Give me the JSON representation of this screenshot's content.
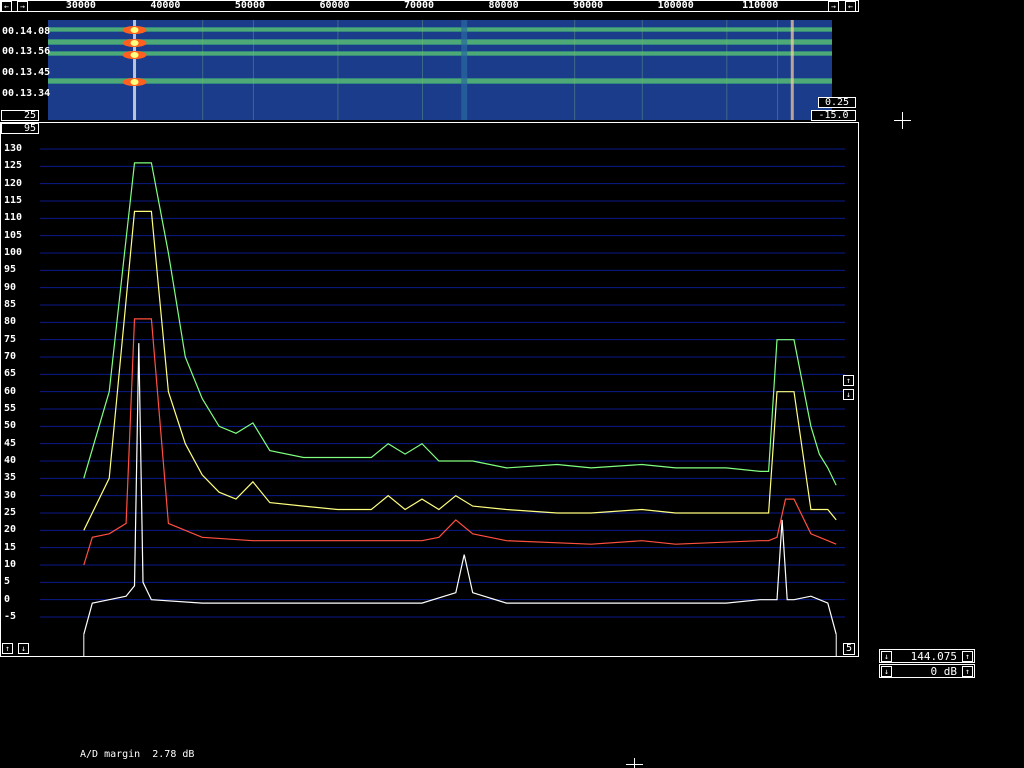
{
  "window": {
    "title": ""
  },
  "waterfall": {
    "freq_ticks": [
      "30000",
      "40000",
      "50000",
      "60000",
      "70000",
      "80000",
      "90000",
      "100000",
      "110000"
    ],
    "time_labels": [
      "00.14.08",
      "00.13.56",
      "00.13.45",
      "00.13.34"
    ],
    "left_value": "25",
    "right_top_value": "0.25",
    "right_bottom_value": "-15.0"
  },
  "spectrum": {
    "top_left_value": "95",
    "y_ticks": [
      "130",
      "125",
      "120",
      "115",
      "110",
      "105",
      "100",
      "95",
      "90",
      "85",
      "80",
      "75",
      "70",
      "65",
      "60",
      "55",
      "50",
      "45",
      "40",
      "35",
      "30",
      "25",
      "20",
      "15",
      "10",
      "5",
      "0",
      "-5"
    ],
    "bottom_right_value": "5"
  },
  "controls": {
    "freq_value": "144.075",
    "gain_value": "0 dB"
  },
  "status": {
    "ad_margin_label": "A/D margin",
    "ad_margin_value": "2.78 dB"
  },
  "colors": {
    "grid": "#0b1a8a",
    "green": "#80ff80",
    "yellow": "#ffff80",
    "red": "#ff5040",
    "white": "#ffffff",
    "waterfall_bg": "#1a3c8a"
  },
  "chart_data": {
    "type": "line",
    "ylim": [
      -5,
      130
    ],
    "xlim": [
      30000,
      120000
    ],
    "series": [
      {
        "color": "green",
        "x": [
          30000,
          33000,
          36000,
          38000,
          40000,
          42000,
          44000,
          46000,
          48000,
          50000,
          52000,
          56000,
          60000,
          64000,
          66000,
          68000,
          70000,
          72000,
          76000,
          80000,
          86000,
          90000,
          96000,
          100000,
          106000,
          110000,
          111000,
          112000,
          114000,
          116000,
          117000,
          118000,
          119000
        ],
        "y": [
          35,
          60,
          126,
          126,
          100,
          70,
          58,
          50,
          48,
          51,
          43,
          41,
          41,
          41,
          45,
          42,
          45,
          40,
          40,
          38,
          39,
          38,
          39,
          38,
          38,
          37,
          37,
          75,
          75,
          50,
          42,
          38,
          33
        ]
      },
      {
        "color": "yellow",
        "x": [
          30000,
          33000,
          36000,
          38000,
          40000,
          42000,
          44000,
          46000,
          48000,
          50000,
          52000,
          56000,
          60000,
          64000,
          66000,
          68000,
          70000,
          72000,
          74000,
          76000,
          80000,
          86000,
          90000,
          96000,
          100000,
          106000,
          110000,
          111000,
          112000,
          114000,
          116000,
          118000,
          119000
        ],
        "y": [
          20,
          35,
          112,
          112,
          60,
          45,
          36,
          31,
          29,
          34,
          28,
          27,
          26,
          26,
          30,
          26,
          29,
          26,
          30,
          27,
          26,
          25,
          25,
          26,
          25,
          25,
          25,
          25,
          60,
          60,
          26,
          26,
          23
        ]
      },
      {
        "color": "red",
        "x": [
          30000,
          31000,
          33000,
          35000,
          36000,
          38000,
          40000,
          44000,
          50000,
          56000,
          64000,
          70000,
          72000,
          74000,
          76000,
          80000,
          90000,
          96000,
          100000,
          110000,
          111000,
          112000,
          113000,
          114000,
          116000,
          118000,
          119000
        ],
        "y": [
          10,
          18,
          19,
          22,
          81,
          81,
          22,
          18,
          17,
          17,
          17,
          17,
          18,
          23,
          19,
          17,
          16,
          17,
          16,
          17,
          17,
          18,
          29,
          29,
          19,
          17,
          16
        ]
      },
      {
        "color": "white",
        "x": [
          30000,
          31000,
          33000,
          35000,
          36000,
          36500,
          37000,
          38000,
          44000,
          50000,
          56000,
          60000,
          64000,
          70000,
          74000,
          75000,
          76000,
          80000,
          86000,
          90000,
          96000,
          100000,
          106000,
          110000,
          112000,
          112600,
          113200,
          114000,
          116000,
          118000,
          119000
        ],
        "y": [
          -10,
          -1,
          0,
          1,
          4,
          74,
          5,
          0,
          -1,
          -1,
          -1,
          -1,
          -1,
          -1,
          2,
          13,
          2,
          -1,
          -1,
          -1,
          -1,
          -1,
          -1,
          0,
          0,
          23,
          0,
          0,
          1,
          -1,
          -10
        ]
      }
    ]
  }
}
